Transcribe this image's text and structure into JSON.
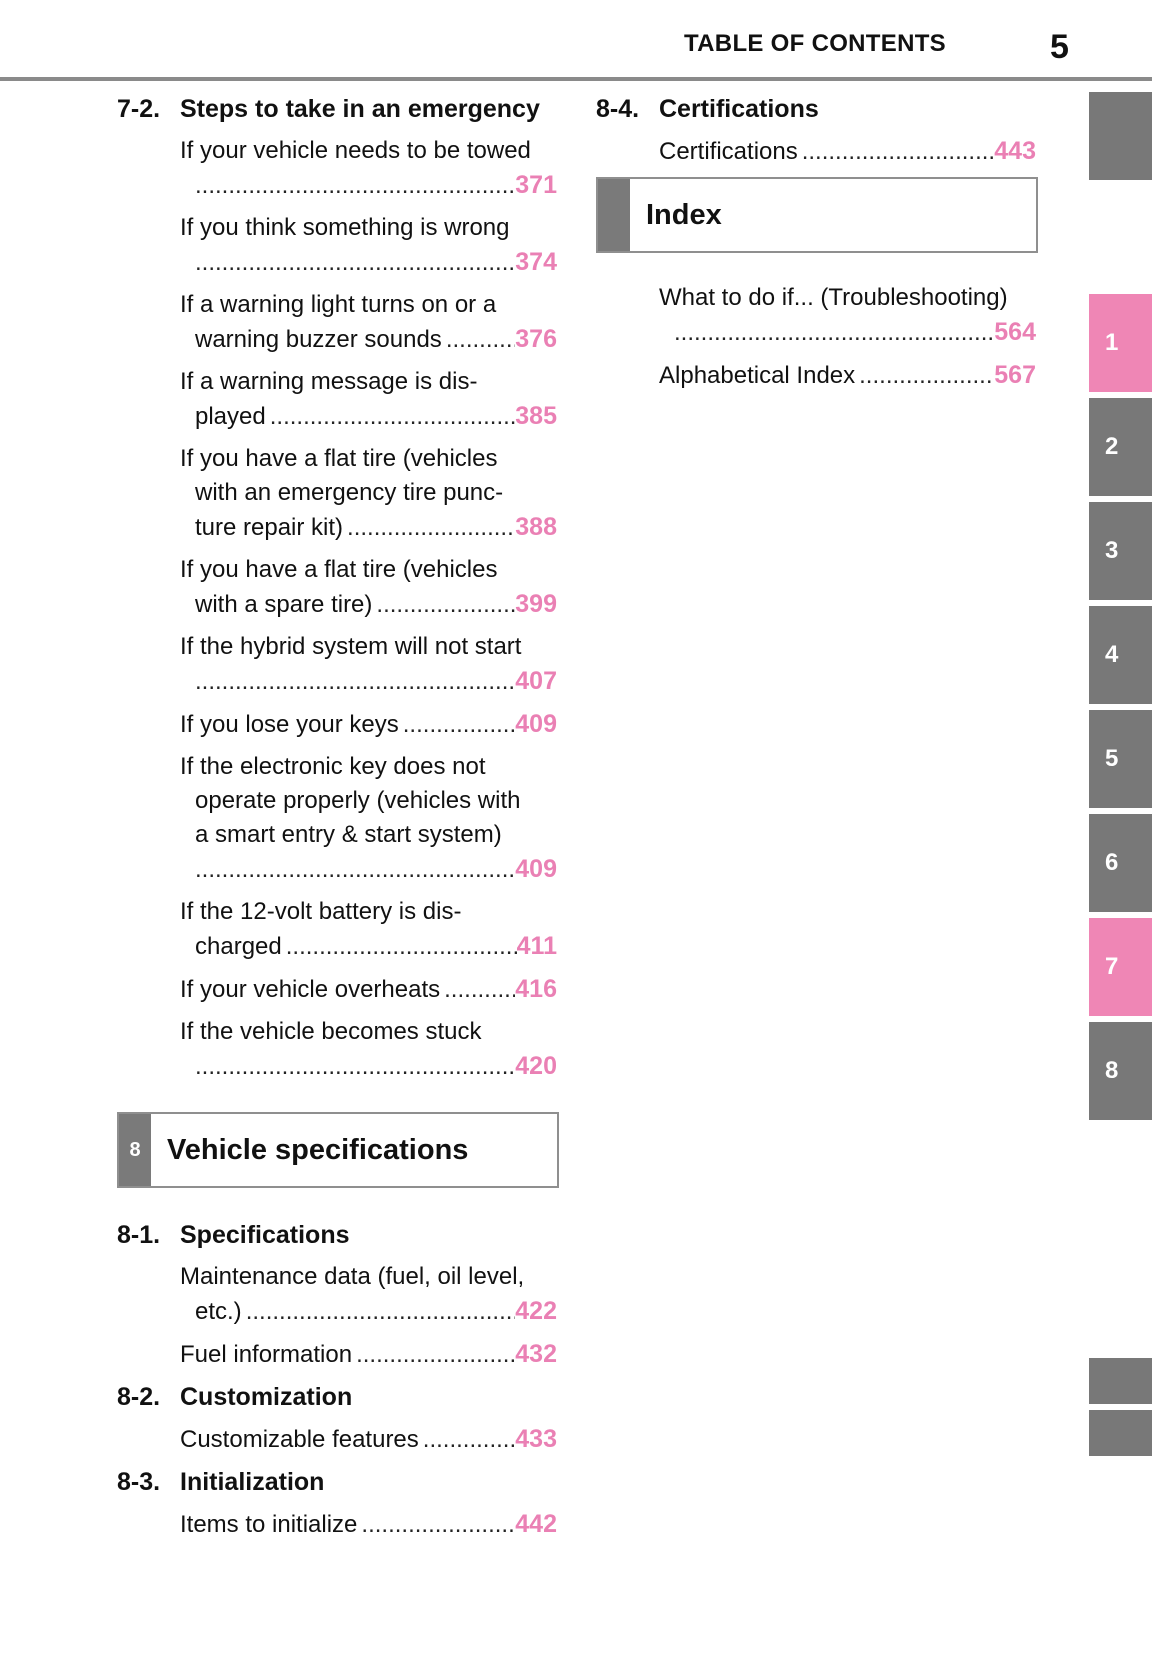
{
  "header": {
    "title": "TABLE OF CONTENTS",
    "page_number": "5"
  },
  "colors": {
    "accent_pink": "#ef86b5",
    "tab_gray": "#787878",
    "page_num_pink": "#ea80b4"
  },
  "left_column": {
    "section_7_2": {
      "num": "7-2.",
      "title": "Steps to take in an emergency",
      "entries": [
        {
          "lines": [
            "If your vehicle needs to be towed"
          ],
          "last": "",
          "page": "371"
        },
        {
          "lines": [
            "If you think something is wrong"
          ],
          "last": "",
          "page": "374"
        },
        {
          "lines": [
            "If a warning light turns on or a"
          ],
          "last": "warning buzzer sounds",
          "page": "376"
        },
        {
          "lines": [
            "If a warning message is dis-"
          ],
          "last": "played",
          "page": "385"
        },
        {
          "lines": [
            "If you have a flat tire (vehicles",
            "with an emergency tire punc-"
          ],
          "last": "ture repair kit)",
          "page": "388"
        },
        {
          "lines": [
            "If you have a flat tire (vehicles"
          ],
          "last": "with a spare tire)",
          "page": "399"
        },
        {
          "lines": [
            "If the hybrid system will not start"
          ],
          "last": "",
          "page": "407"
        },
        {
          "lines": [],
          "last": "If you lose your keys",
          "page": "409"
        },
        {
          "lines": [
            "If the electronic key does not",
            "operate properly (vehicles with",
            "a smart entry & start system)"
          ],
          "last": "",
          "page": "409"
        },
        {
          "lines": [
            "If the 12-volt battery is dis-"
          ],
          "last": "charged",
          "page": "411"
        },
        {
          "lines": [],
          "last": "If your vehicle overheats",
          "page": "416"
        },
        {
          "lines": [
            "If the vehicle becomes stuck"
          ],
          "last": "",
          "page": "420"
        }
      ]
    },
    "chapter_8": {
      "badge": "8",
      "title": "Vehicle specifications"
    },
    "section_8_1": {
      "num": "8-1.",
      "title": "Specifications",
      "entries": [
        {
          "lines": [
            "Maintenance data (fuel, oil level,"
          ],
          "last": "etc.)",
          "page": "422"
        },
        {
          "lines": [],
          "last": "Fuel information",
          "page": "432"
        }
      ]
    },
    "section_8_2": {
      "num": "8-2.",
      "title": "Customization",
      "entries": [
        {
          "lines": [],
          "last": "Customizable features",
          "page": "433"
        }
      ]
    },
    "section_8_3": {
      "num": "8-3.",
      "title": "Initialization",
      "entries": [
        {
          "lines": [],
          "last": "Items to initialize",
          "page": "442"
        }
      ]
    }
  },
  "right_column": {
    "section_8_4": {
      "num": "8-4.",
      "title": "Certifications",
      "entries": [
        {
          "lines": [],
          "last": "Certifications",
          "page": "443"
        }
      ]
    },
    "index": {
      "title": "Index",
      "entries": [
        {
          "lines": [
            "What to do if... (Troubleshooting)"
          ],
          "last": "",
          "page": "564"
        },
        {
          "lines": [],
          "last": "Alphabetical Index",
          "page": "567"
        }
      ]
    }
  },
  "side_tabs": [
    {
      "label": "",
      "active": false
    },
    {
      "label": "1",
      "active": true
    },
    {
      "label": "2",
      "active": false
    },
    {
      "label": "3",
      "active": false
    },
    {
      "label": "4",
      "active": false
    },
    {
      "label": "5",
      "active": false
    },
    {
      "label": "6",
      "active": false
    },
    {
      "label": "7",
      "active": true
    },
    {
      "label": "8",
      "active": false
    },
    {
      "label": "",
      "active": false
    },
    {
      "label": "",
      "active": false
    }
  ]
}
